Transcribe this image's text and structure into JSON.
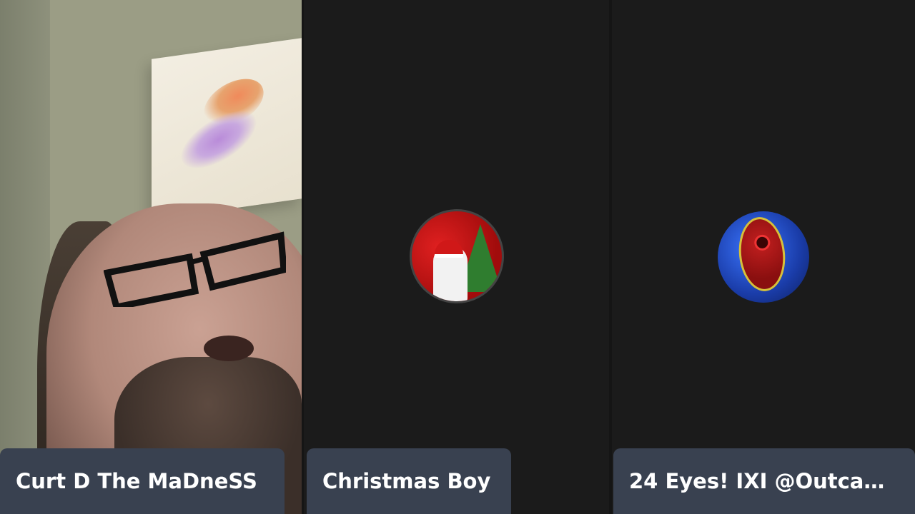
{
  "participants": [
    {
      "name": "Curt D The MaDneSS",
      "video": "camera-feed"
    },
    {
      "name": "Christmas Boy",
      "video": "avatar-christmas-image"
    },
    {
      "name": "24 Eyes! IXI @Outca…",
      "video": "avatar-blue-red-emblem"
    }
  ],
  "colors": {
    "background": "#151515",
    "tile_background": "#1b1b1b",
    "name_bar": "#394150",
    "name_text": "#ffffff"
  }
}
